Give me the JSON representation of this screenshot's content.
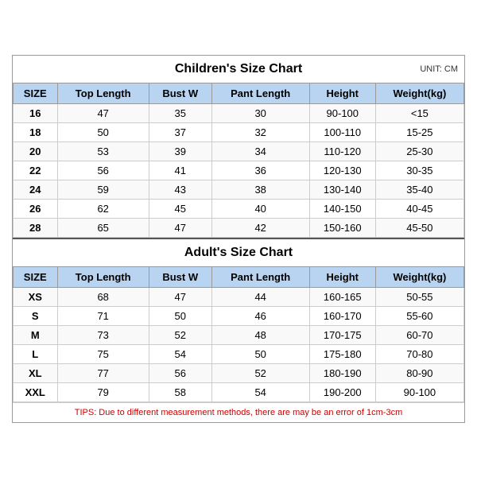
{
  "children_section": {
    "title": "Children's Size Chart",
    "unit": "UNIT: CM",
    "headers": [
      "SIZE",
      "Top Length",
      "Bust W",
      "Pant Length",
      "Height",
      "Weight(kg)"
    ],
    "rows": [
      [
        "16",
        "47",
        "35",
        "30",
        "90-100",
        "<15"
      ],
      [
        "18",
        "50",
        "37",
        "32",
        "100-110",
        "15-25"
      ],
      [
        "20",
        "53",
        "39",
        "34",
        "110-120",
        "25-30"
      ],
      [
        "22",
        "56",
        "41",
        "36",
        "120-130",
        "30-35"
      ],
      [
        "24",
        "59",
        "43",
        "38",
        "130-140",
        "35-40"
      ],
      [
        "26",
        "62",
        "45",
        "40",
        "140-150",
        "40-45"
      ],
      [
        "28",
        "65",
        "47",
        "42",
        "150-160",
        "45-50"
      ]
    ]
  },
  "adult_section": {
    "title": "Adult's Size Chart",
    "headers": [
      "SIZE",
      "Top Length",
      "Bust W",
      "Pant Length",
      "Height",
      "Weight(kg)"
    ],
    "rows": [
      [
        "XS",
        "68",
        "47",
        "44",
        "160-165",
        "50-55"
      ],
      [
        "S",
        "71",
        "50",
        "46",
        "160-170",
        "55-60"
      ],
      [
        "M",
        "73",
        "52",
        "48",
        "170-175",
        "60-70"
      ],
      [
        "L",
        "75",
        "54",
        "50",
        "175-180",
        "70-80"
      ],
      [
        "XL",
        "77",
        "56",
        "52",
        "180-190",
        "80-90"
      ],
      [
        "XXL",
        "79",
        "58",
        "54",
        "190-200",
        "90-100"
      ]
    ]
  },
  "tips": "TIPS: Due to different measurement methods, there are may be an error of 1cm-3cm"
}
